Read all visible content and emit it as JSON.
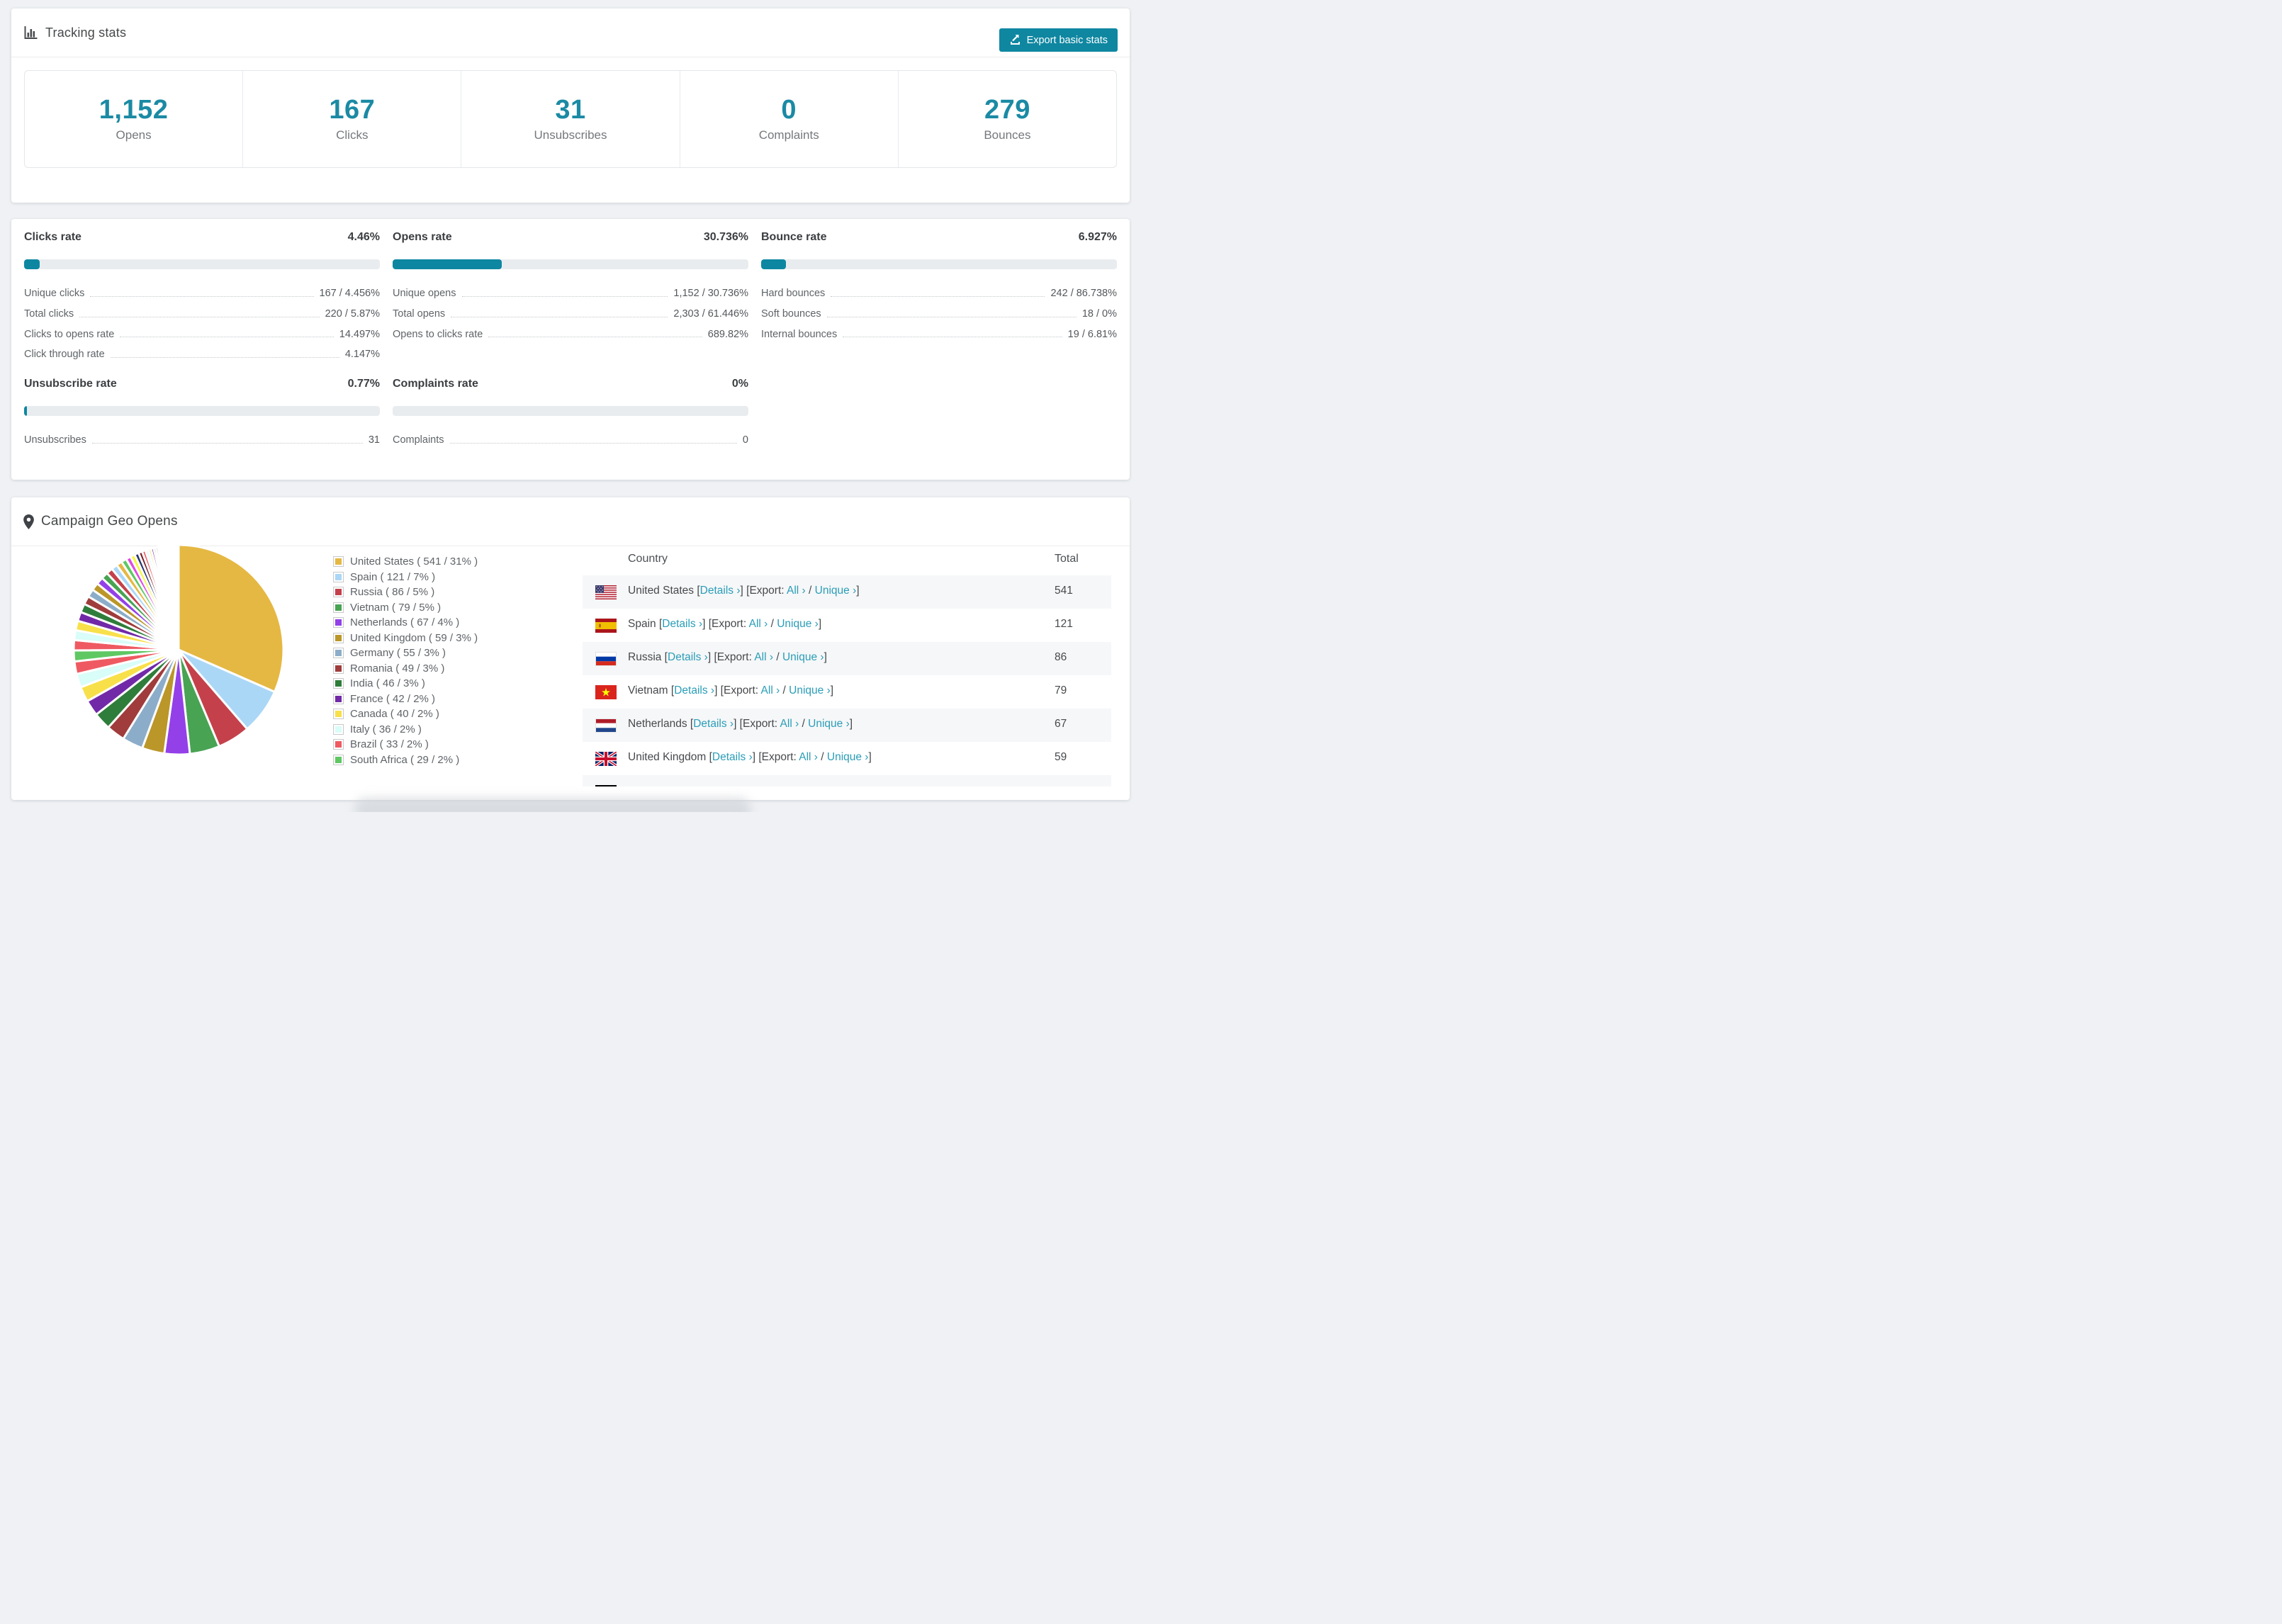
{
  "colors": {
    "accent": "#1b8aa4",
    "button": "#0f87a1",
    "bar_fill": "#0d87a1",
    "link": "#2a9db8"
  },
  "header": {
    "title": "Tracking stats",
    "icon": "bar-chart-icon",
    "export_button": "Export basic stats"
  },
  "summary_stats": [
    {
      "value": "1,152",
      "label": "Opens"
    },
    {
      "value": "167",
      "label": "Clicks"
    },
    {
      "value": "31",
      "label": "Unsubscribes"
    },
    {
      "value": "0",
      "label": "Complaints"
    },
    {
      "value": "279",
      "label": "Bounces"
    }
  ],
  "rate_blocks": [
    {
      "title": "Clicks rate",
      "value": "4.46%",
      "percent": 4.46,
      "rows": [
        [
          "Unique clicks",
          "167 / 4.456%"
        ],
        [
          "Total clicks",
          "220 / 5.87%"
        ],
        [
          "Clicks to opens rate",
          "14.497%"
        ],
        [
          "Click through rate",
          "4.147%"
        ]
      ]
    },
    {
      "title": "Opens rate",
      "value": "30.736%",
      "percent": 30.736,
      "rows": [
        [
          "Unique opens",
          "1,152 / 30.736%"
        ],
        [
          "Total opens",
          "2,303 / 61.446%"
        ],
        [
          "Opens to clicks rate",
          "689.82%"
        ]
      ]
    },
    {
      "title": "Bounce rate",
      "value": "6.927%",
      "percent": 6.927,
      "rows": [
        [
          "Hard bounces",
          "242 / 86.738%"
        ],
        [
          "Soft bounces",
          "18 / 0%"
        ],
        [
          "Internal bounces",
          "19 / 6.81%"
        ]
      ]
    },
    {
      "title": "Unsubscribe rate",
      "value": "0.77%",
      "percent": 0.77,
      "rows": [
        [
          "Unsubscribes",
          "31"
        ]
      ]
    },
    {
      "title": "Complaints rate",
      "value": "0%",
      "percent": 0,
      "rows": [
        [
          "Complaints",
          "0"
        ]
      ]
    }
  ],
  "geo": {
    "title": "Campaign Geo Opens",
    "icon": "map-pin-icon",
    "table": {
      "headers": [
        "Country",
        "Total"
      ],
      "link_labels": {
        "details": "Details ›",
        "export_word": "Export:",
        "all": "All ›",
        "unique": "Unique ›"
      },
      "rows": [
        {
          "flag": "us",
          "country": "United States",
          "total": "541"
        },
        {
          "flag": "es",
          "country": "Spain",
          "total": "121"
        },
        {
          "flag": "ru",
          "country": "Russia",
          "total": "86"
        },
        {
          "flag": "vn",
          "country": "Vietnam",
          "total": "79"
        },
        {
          "flag": "nl",
          "country": "Netherlands",
          "total": "67"
        },
        {
          "flag": "gb",
          "country": "United Kingdom",
          "total": "59"
        },
        {
          "flag": "de",
          "country": "",
          "total": ""
        }
      ]
    }
  },
  "chart_data": {
    "type": "pie",
    "title": "Campaign Geo Opens",
    "legend_position": "right",
    "start_angle_deg": -90,
    "direction": "clockwise",
    "slices": [
      {
        "label": "United States",
        "value": 541,
        "percent": "31%",
        "color": "#e5b843"
      },
      {
        "label": "Spain",
        "value": 121,
        "percent": "7%",
        "color": "#abd7f7"
      },
      {
        "label": "Russia",
        "value": 86,
        "percent": "5%",
        "color": "#c4414b"
      },
      {
        "label": "Vietnam",
        "value": 79,
        "percent": "5%",
        "color": "#48a353"
      },
      {
        "label": "Netherlands",
        "value": 67,
        "percent": "4%",
        "color": "#9340e8"
      },
      {
        "label": "United Kingdom",
        "value": 59,
        "percent": "3%",
        "color": "#bb9629"
      },
      {
        "label": "Germany",
        "value": 55,
        "percent": "3%",
        "color": "#8cadc9"
      },
      {
        "label": "Romania",
        "value": 49,
        "percent": "3%",
        "color": "#a03c3c"
      },
      {
        "label": "India",
        "value": 46,
        "percent": "3%",
        "color": "#2f7d3a"
      },
      {
        "label": "France",
        "value": 42,
        "percent": "2%",
        "color": "#7229a8"
      },
      {
        "label": "Canada",
        "value": 40,
        "percent": "2%",
        "color": "#f8e04a"
      },
      {
        "label": "Italy",
        "value": 36,
        "percent": "2%",
        "color": "#d9fdf8"
      },
      {
        "label": "Brazil",
        "value": 33,
        "percent": "2%",
        "color": "#ef5a62"
      },
      {
        "label": "South Africa",
        "value": 29,
        "percent": "2%",
        "color": "#5fc863"
      }
    ],
    "small_slices_estimated": [
      27,
      26,
      25,
      24,
      23,
      22,
      21,
      20,
      19,
      18,
      17,
      16,
      15,
      14,
      13,
      12,
      11,
      10,
      9,
      8,
      7,
      7,
      6,
      6,
      5,
      5,
      4,
      4,
      3,
      3,
      3,
      3,
      2,
      2,
      2,
      2,
      2,
      2,
      1,
      1,
      1,
      1,
      1,
      1,
      1,
      1,
      1,
      1,
      1,
      1
    ],
    "small_slice_palette": [
      "#ef5a62",
      "#d9fdf8",
      "#f8e04a",
      "#7229a8",
      "#2f7d3a",
      "#a03c3c",
      "#8cadc9",
      "#bb9629",
      "#9340e8",
      "#48a353",
      "#c4414b",
      "#abd7f7",
      "#e5b843",
      "#5fc863",
      "#e04ce0",
      "#f6f63e",
      "#28346e",
      "#7a1f24"
    ]
  }
}
